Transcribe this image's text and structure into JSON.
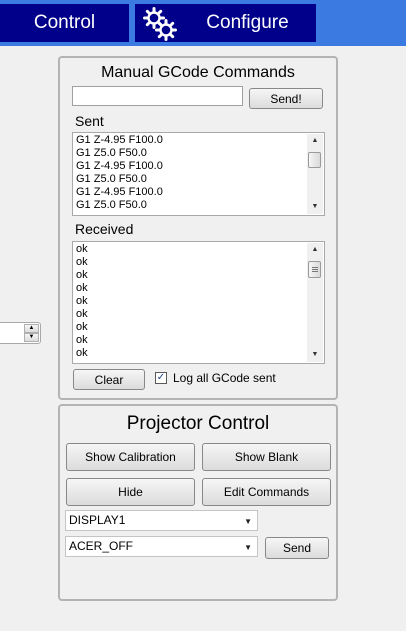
{
  "tabs": [
    {
      "label": "Control"
    },
    {
      "label": "Configure",
      "icon": "gears-icon"
    }
  ],
  "gcode_panel": {
    "title": "Manual GCode Commands",
    "command_value": "",
    "send_label": "Send!",
    "sent_label": "Sent",
    "sent_lines": [
      "G1 Z-4.95 F100.0",
      "G1 Z5.0 F50.0",
      "G1 Z-4.95 F100.0",
      "G1 Z5.0 F50.0",
      "G1 Z-4.95 F100.0",
      "G1 Z5.0 F50.0"
    ],
    "received_label": "Received",
    "received_lines": [
      "ok",
      "ok",
      "ok",
      "ok",
      "ok",
      "ok",
      "ok",
      "ok",
      "ok"
    ],
    "clear_label": "Clear",
    "log_checkbox_label": "Log all GCode sent",
    "log_checked": true
  },
  "projector_panel": {
    "title": "Projector Control",
    "show_calibration_label": "Show Calibration",
    "show_blank_label": "Show Blank",
    "hide_label": "Hide",
    "edit_commands_label": "Edit Commands",
    "display_selected": "DISPLAY1",
    "command_selected": "ACER_OFF",
    "send_label": "Send"
  },
  "colors": {
    "tab_bar": "#3b7ae0",
    "tab": "#00008b",
    "tab_text": "#ffffff",
    "background": "#f0f0f0"
  }
}
